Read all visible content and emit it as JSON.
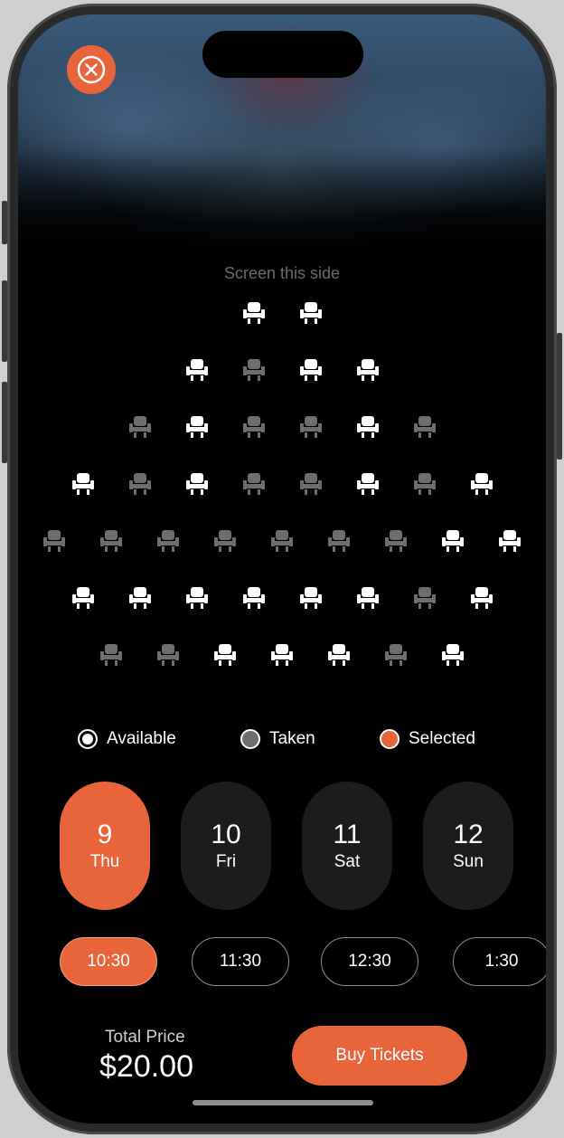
{
  "screen_label": "Screen this side",
  "seat_rows": [
    [
      "available",
      "available"
    ],
    [
      "available",
      "taken",
      "available",
      "available"
    ],
    [
      "taken",
      "available",
      "taken",
      "taken",
      "available",
      "taken"
    ],
    [
      "available",
      "taken",
      "available",
      "taken",
      "taken",
      "available",
      "taken",
      "available"
    ],
    [
      "taken",
      "taken",
      "taken",
      "taken",
      "taken",
      "taken",
      "taken",
      "available",
      "available"
    ],
    [
      "available",
      "selected",
      "selected",
      "selected",
      "selected",
      "available",
      "taken",
      "available"
    ],
    [
      "taken",
      "taken",
      "available",
      "available",
      "available",
      "taken",
      "available"
    ]
  ],
  "legend": {
    "available": "Available",
    "taken": "Taken",
    "selected": "Selected"
  },
  "dates": [
    {
      "num": "9",
      "day": "Thu",
      "active": true
    },
    {
      "num": "10",
      "day": "Fri",
      "active": false
    },
    {
      "num": "11",
      "day": "Sat",
      "active": false
    },
    {
      "num": "12",
      "day": "Sun",
      "active": false
    }
  ],
  "times": [
    {
      "label": "10:30",
      "active": true
    },
    {
      "label": "11:30",
      "active": false
    },
    {
      "label": "12:30",
      "active": false
    },
    {
      "label": "1:30",
      "active": false
    }
  ],
  "total": {
    "label": "Total Price",
    "value": "$20.00"
  },
  "buy_label": "Buy Tickets",
  "colors": {
    "accent": "#e8643a",
    "available": "#ffffff",
    "taken": "#6e6e70",
    "background": "#000000"
  }
}
